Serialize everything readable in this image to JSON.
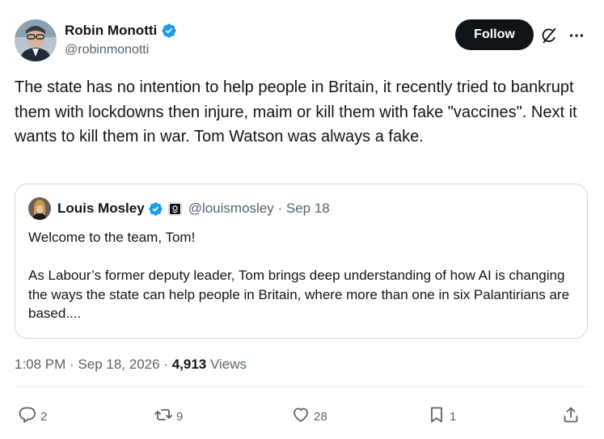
{
  "tweet": {
    "author": {
      "name": "Robin Monotti",
      "handle": "@robinmonotti",
      "verified": true
    },
    "follow_label": "Follow",
    "text": "The state has no intention to help people in Britain, it recently tried to bankrupt them with lockdowns then injure, maim or kill them with fake \"vaccines\". Next it wants to kill them in war. Tom Watson was always a fake.",
    "meta": {
      "time": "1:08 PM",
      "date": "Sep 18, 2026",
      "views_count": "4,913",
      "views_label": "Views"
    },
    "actions": {
      "replies": "2",
      "reposts": "9",
      "likes": "28",
      "bookmarks": "1"
    }
  },
  "quote": {
    "author": {
      "name": "Louis Mosley",
      "handle": "@louismosley",
      "date": "Sep 18"
    },
    "line1": "Welcome to the team, Tom!",
    "line2": "As Labour’s former deputy leader, Tom brings deep understanding of how AI is changing the ways the state can help people in Britain, where more than one in six Palantirians are based...."
  },
  "icons": {
    "verified": "verified-badge-icon",
    "grok": "grok-icon",
    "more": "more-options-icon",
    "affiliate": "affiliate-badge-icon",
    "reply": "reply-icon",
    "repost": "repost-icon",
    "like": "heart-icon",
    "bookmark": "bookmark-icon",
    "share": "share-icon"
  },
  "colors": {
    "verified_blue": "#1d9bf0",
    "text_primary": "#0f1419",
    "text_secondary": "#536471",
    "follow_bg": "#0f1419"
  }
}
